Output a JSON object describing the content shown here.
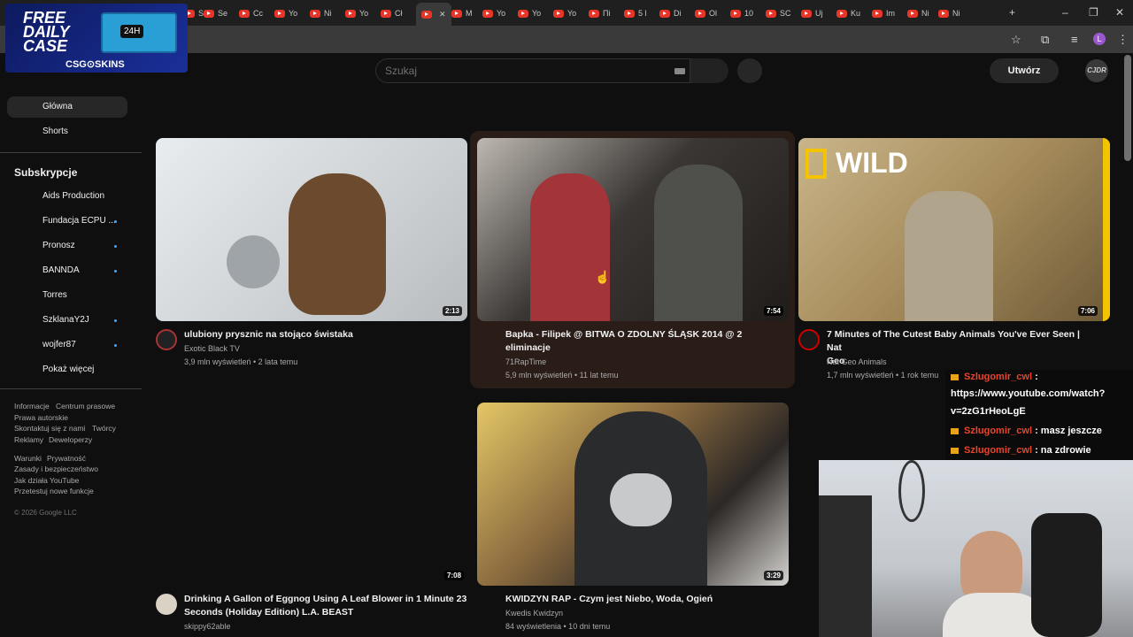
{
  "browser": {
    "tabs": [
      "S",
      "Se",
      "Cc",
      "Yo",
      "Ni",
      "Yo",
      "Cł",
      "",
      "M",
      "Yo",
      "Yo",
      "Yo",
      "Пi",
      "5 l",
      "Di",
      "Ol",
      "10",
      "SC",
      "Uj",
      "Ku",
      "Im",
      "Ni",
      "Ni"
    ],
    "new_tab": "+",
    "profile_initial": "L"
  },
  "promo": {
    "line1": "FREE",
    "line2": "DAILY",
    "line3": "CASE",
    "badge": "24H",
    "brand": "CSG⊙SKINS"
  },
  "header": {
    "search_placeholder": "Szukaj",
    "create_label": "Utwórz",
    "avatar_text": "CJDR"
  },
  "sidebar": {
    "main": [
      {
        "label": "Główna",
        "active": true
      },
      {
        "label": "Shorts",
        "active": false
      }
    ],
    "subscriptions_title": "Subskrypcje",
    "subscriptions": [
      {
        "label": "Aids Production",
        "new": false
      },
      {
        "label": "Fundacja ECPU ...",
        "new": true
      },
      {
        "label": "Pronosz",
        "new": true
      },
      {
        "label": "BANNDA",
        "new": true
      },
      {
        "label": "Torres",
        "new": false
      },
      {
        "label": "SzklanaY2J",
        "new": true
      },
      {
        "label": "wojfer87",
        "new": true
      },
      {
        "label": "Pokaż więcej",
        "new": false
      }
    ],
    "footer1": [
      "Informacje",
      "Centrum prasowe",
      "Prawa autorskie",
      "Skontaktuj się z nami",
      "Twórcy",
      "Reklamy",
      "Deweloperzy"
    ],
    "footer2": [
      "Warunki",
      "Prywatność",
      "Zasady i bezpieczeństwo",
      "Jak działa YouTube",
      "Przetestuj nowe funkcje"
    ],
    "copyright": "© 2026 Google LLC"
  },
  "videos": [
    {
      "title_line1": "ulubiony prysznic na stojąco świstaka",
      "title_line2": "",
      "channel": "Exotic Black TV",
      "meta": "3,9 mln wyświetleń • 2 lata temu",
      "duration": "2:13"
    },
    {
      "title_line1": "Bapka - Filipek @ BITWA O ZDOLNY ŚLĄSK 2014 @ 2",
      "title_line2": "eliminacje",
      "channel": "71RapTime",
      "meta": "5,9 mln wyświetleń • 11 lat temu",
      "duration": "7:54"
    },
    {
      "title_line1": "7 Minutes of The Cutest Baby Animals You've Ever Seen | Nat",
      "title_line2": "Geo",
      "channel": "Nat Geo Animals",
      "meta": "1,7 mln wyświetleń • 1 rok temu",
      "duration": "7:06",
      "thumb_brand": "WILD"
    },
    {
      "title_line1": "Drinking A Gallon of Eggnog Using A Leaf Blower in 1 Minute 23",
      "title_line2": "Seconds (Holiday Edition) L.A. BEAST",
      "channel": "skippy62able",
      "meta": "",
      "duration": "7:08"
    },
    {
      "title_line1": "KWIDZYN RAP - Czym jest Niebo, Woda, Ogień",
      "title_line2": "",
      "channel": "Kwedis Kwidzyn",
      "meta": "84 wyświetlenia • 10 dni temu",
      "duration": "3:29"
    }
  ],
  "chat": [
    {
      "user": "Szlugomir_cwl",
      "text": " :"
    },
    {
      "user": "",
      "text": "https://www.youtube.com/watch?"
    },
    {
      "user": "",
      "text": "v=2zG1rHeoLgE"
    },
    {
      "user": "Szlugomir_cwl",
      "text": " : masz jeszcze"
    },
    {
      "user": "Szlugomir_cwl",
      "text": " : na zdrowie"
    }
  ],
  "colors": {
    "background": "#0f0f0f",
    "accent_dot": "#3ea6ff",
    "chat_user": "#e8452c"
  }
}
